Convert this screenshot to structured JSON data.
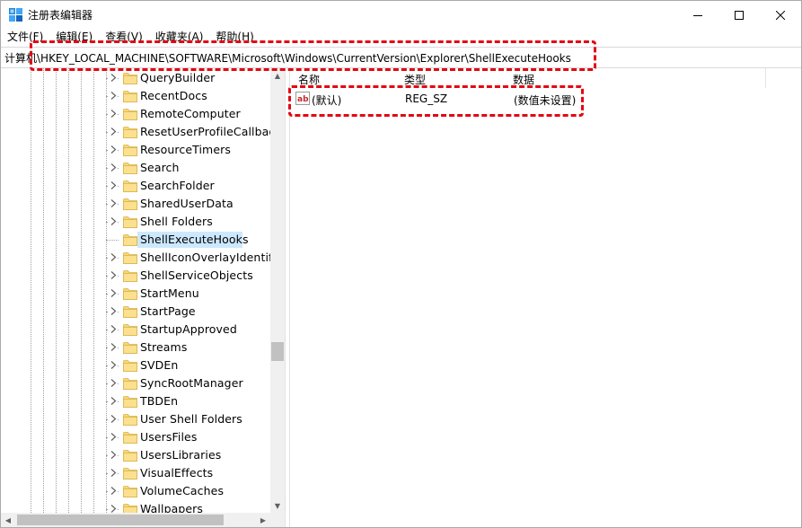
{
  "window": {
    "title": "注册表编辑器"
  },
  "window_controls": {
    "minimize": "—",
    "maximize": "☐",
    "close": "✕"
  },
  "menu": [
    "文件(F)",
    "编辑(E)",
    "查看(V)",
    "收藏夹(A)",
    "帮助(H)"
  ],
  "address": {
    "path": "计算机\\HKEY_LOCAL_MACHINE\\SOFTWARE\\Microsoft\\Windows\\CurrentVersion\\Explorer\\ShellExecuteHooks"
  },
  "tree": {
    "items": [
      {
        "label": "QueryBuilder",
        "expandable": true
      },
      {
        "label": "RecentDocs",
        "expandable": true
      },
      {
        "label": "RemoteComputer",
        "expandable": true
      },
      {
        "label": "ResetUserProfileCallback",
        "expandable": true
      },
      {
        "label": "ResourceTimers",
        "expandable": true
      },
      {
        "label": "Search",
        "expandable": true
      },
      {
        "label": "SearchFolder",
        "expandable": true
      },
      {
        "label": "SharedUserData",
        "expandable": true
      },
      {
        "label": "Shell Folders",
        "expandable": true
      },
      {
        "label": "ShellExecuteHooks",
        "expandable": false,
        "selected": true
      },
      {
        "label": "ShellIconOverlayIdentifie",
        "expandable": true
      },
      {
        "label": "ShellServiceObjects",
        "expandable": true
      },
      {
        "label": "StartMenu",
        "expandable": true
      },
      {
        "label": "StartPage",
        "expandable": true
      },
      {
        "label": "StartupApproved",
        "expandable": true
      },
      {
        "label": "Streams",
        "expandable": true
      },
      {
        "label": "SVDEn",
        "expandable": true
      },
      {
        "label": "SyncRootManager",
        "expandable": true
      },
      {
        "label": "TBDEn",
        "expandable": true
      },
      {
        "label": "User Shell Folders",
        "expandable": true
      },
      {
        "label": "UsersFiles",
        "expandable": true
      },
      {
        "label": "UsersLibraries",
        "expandable": true
      },
      {
        "label": "VisualEffects",
        "expandable": true
      },
      {
        "label": "VolumeCaches",
        "expandable": true
      },
      {
        "label": "Wallpapers",
        "expandable": true
      }
    ]
  },
  "values_pane": {
    "columns": {
      "name": "名称",
      "type": "类型",
      "data": "数据"
    },
    "rows": [
      {
        "name": "(默认)",
        "type": "REG_SZ",
        "data": "(数值未设置)",
        "icon": "ab-string-icon"
      }
    ]
  },
  "colors": {
    "highlight": "#e30613",
    "selection": "#cce8ff",
    "folder": "#f8d775"
  }
}
